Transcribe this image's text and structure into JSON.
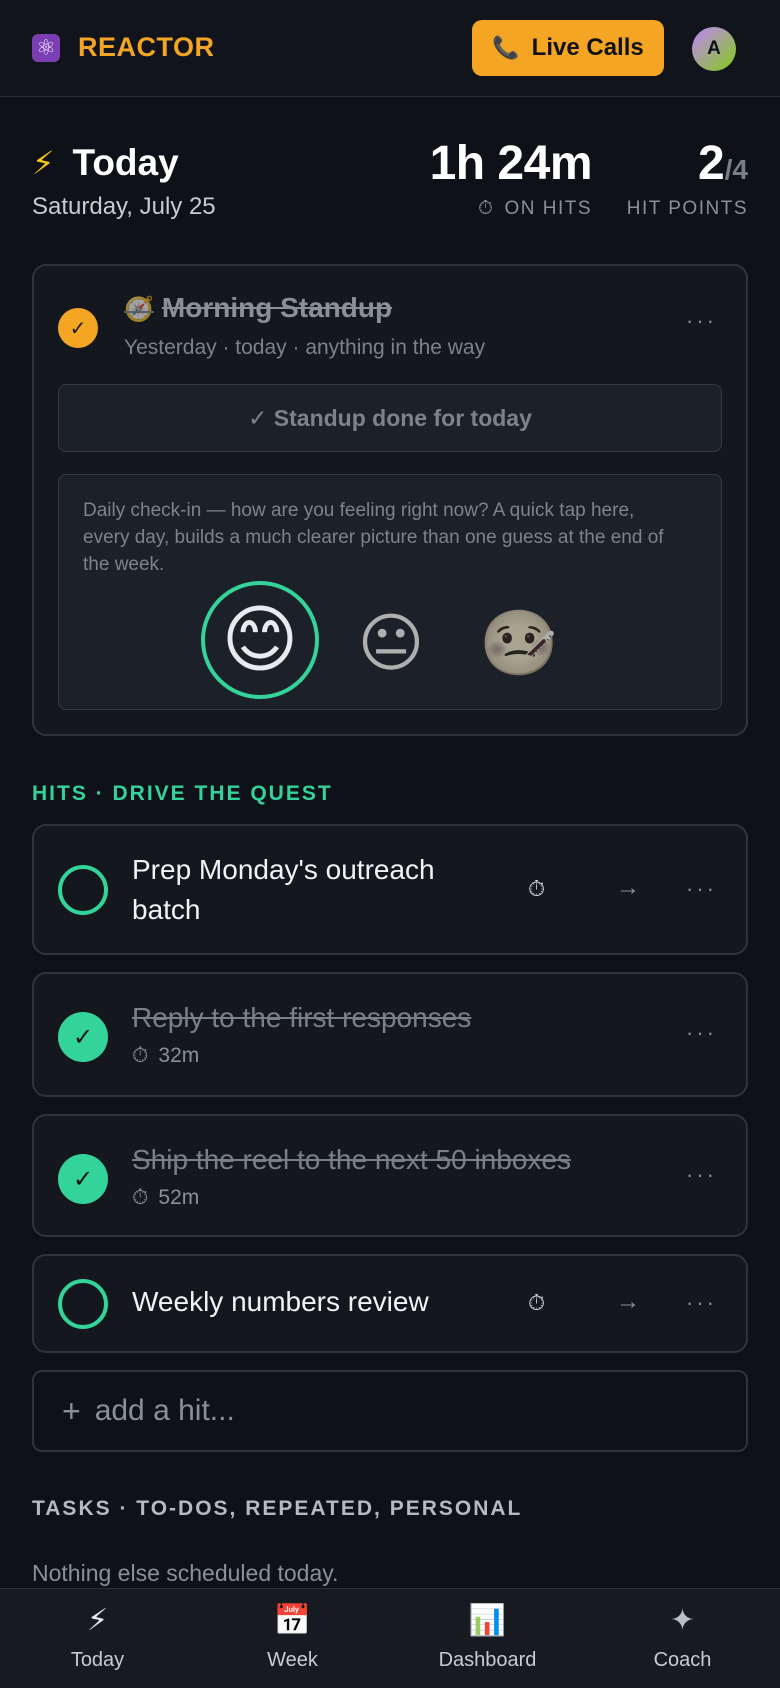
{
  "header": {
    "brand_icon": "atom-icon",
    "brand_name": "REACTOR",
    "live_calls_label": "Live Calls",
    "avatar_initial": "A"
  },
  "today": {
    "title": "Today",
    "date": "Saturday, July 25",
    "time_on_hits": "1h 24m",
    "time_label": "ON HITS",
    "points_value": "2",
    "points_total": "/4",
    "points_label": "HIT POINTS"
  },
  "standup": {
    "title": "Morning Standup",
    "subtitle": "Yesterday · today · anything in the way",
    "done_label": "✓ Standup done for today",
    "checkin_text": "Daily check-in — how are you feeling right now? A quick tap here, every day, builds a much clearer picture than one guess at the end of the week.",
    "moods": [
      "😊",
      "😐",
      "🤒"
    ],
    "selected_mood": "happy"
  },
  "hits": {
    "heading": "HITS · DRIVE THE QUEST",
    "items": [
      {
        "title": "Prep Monday's outreach batch",
        "done": false,
        "time": ""
      },
      {
        "title": "Reply to the first responses",
        "done": true,
        "time": "32m"
      },
      {
        "title": "Ship the reel to the next 50 inboxes",
        "done": true,
        "time": "52m"
      },
      {
        "title": "Weekly numbers review",
        "done": false,
        "time": ""
      }
    ],
    "add_placeholder": "add a hit..."
  },
  "tasks": {
    "heading": "TASKS · TO-DOS, REPEATED, PERSONAL",
    "empty_text": "Nothing else scheduled today."
  },
  "nav": {
    "items": [
      {
        "label": "Today",
        "icon": "⚡"
      },
      {
        "label": "Week",
        "icon": "📅"
      },
      {
        "label": "Dashboard",
        "icon": "📊"
      },
      {
        "label": "Coach",
        "icon": "✦"
      }
    ]
  },
  "colors": {
    "accent_orange": "#f5a524",
    "accent_green": "#34d399",
    "background": "#0e1117"
  }
}
